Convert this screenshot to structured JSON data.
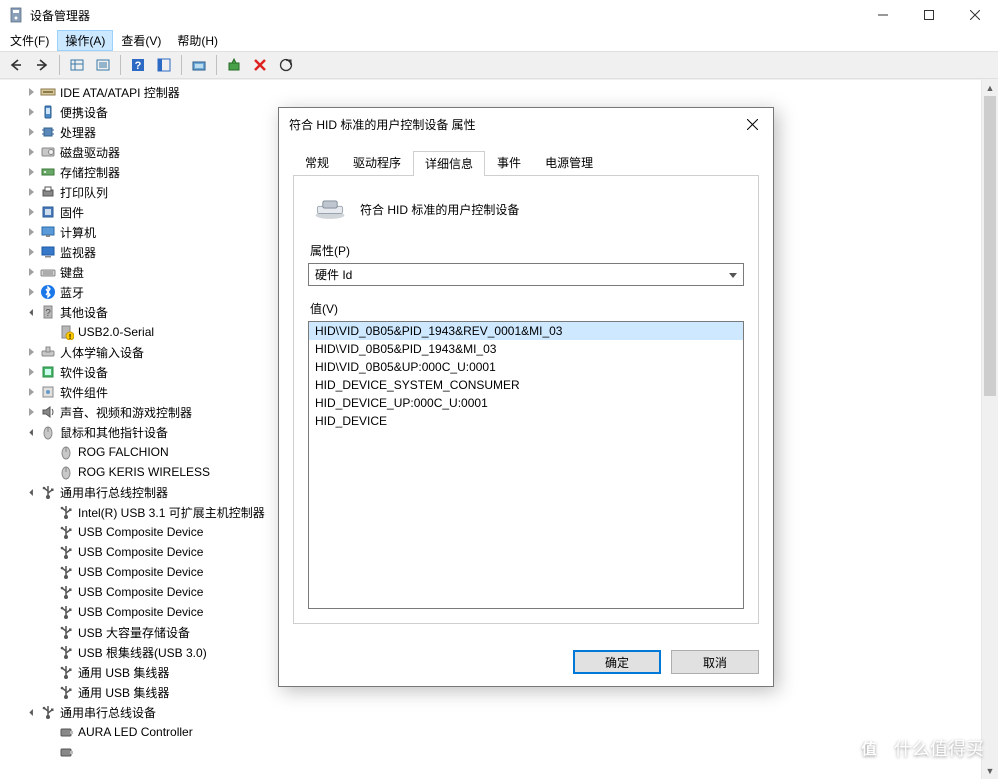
{
  "title": "设备管理器",
  "menus": {
    "file": "文件(F)",
    "action": "操作(A)",
    "view": "查看(V)",
    "help": "帮助(H)"
  },
  "tree": {
    "items": [
      {
        "indent": 1,
        "exp": "closed",
        "icon": "ide",
        "label": "IDE ATA/ATAPI 控制器"
      },
      {
        "indent": 1,
        "exp": "closed",
        "icon": "portable",
        "label": "便携设备"
      },
      {
        "indent": 1,
        "exp": "closed",
        "icon": "cpu",
        "label": "处理器"
      },
      {
        "indent": 1,
        "exp": "closed",
        "icon": "disk",
        "label": "磁盘驱动器"
      },
      {
        "indent": 1,
        "exp": "closed",
        "icon": "storage",
        "label": "存储控制器"
      },
      {
        "indent": 1,
        "exp": "closed",
        "icon": "printer",
        "label": "打印队列"
      },
      {
        "indent": 1,
        "exp": "closed",
        "icon": "firmware",
        "label": "固件"
      },
      {
        "indent": 1,
        "exp": "closed",
        "icon": "computer",
        "label": "计算机"
      },
      {
        "indent": 1,
        "exp": "closed",
        "icon": "monitor",
        "label": "监视器"
      },
      {
        "indent": 1,
        "exp": "closed",
        "icon": "keyboard",
        "label": "键盘"
      },
      {
        "indent": 1,
        "exp": "closed",
        "icon": "bluetooth",
        "label": "蓝牙"
      },
      {
        "indent": 1,
        "exp": "open",
        "icon": "unknown",
        "label": "其他设备"
      },
      {
        "indent": 2,
        "exp": "",
        "icon": "unknown-warn",
        "label": "USB2.0-Serial"
      },
      {
        "indent": 1,
        "exp": "closed",
        "icon": "hid",
        "label": "人体学输入设备"
      },
      {
        "indent": 1,
        "exp": "closed",
        "icon": "software",
        "label": "软件设备"
      },
      {
        "indent": 1,
        "exp": "closed",
        "icon": "component",
        "label": "软件组件"
      },
      {
        "indent": 1,
        "exp": "closed",
        "icon": "audio",
        "label": "声音、视频和游戏控制器"
      },
      {
        "indent": 1,
        "exp": "open",
        "icon": "mouse",
        "label": "鼠标和其他指针设备"
      },
      {
        "indent": 2,
        "exp": "",
        "icon": "mouse",
        "label": "ROG FALCHION"
      },
      {
        "indent": 2,
        "exp": "",
        "icon": "mouse",
        "label": "ROG KERIS WIRELESS"
      },
      {
        "indent": 1,
        "exp": "open",
        "icon": "usb",
        "label": "通用串行总线控制器"
      },
      {
        "indent": 2,
        "exp": "",
        "icon": "usb",
        "label": "Intel(R) USB 3.1 可扩展主机控制器"
      },
      {
        "indent": 2,
        "exp": "",
        "icon": "usb",
        "label": "USB Composite Device"
      },
      {
        "indent": 2,
        "exp": "",
        "icon": "usb",
        "label": "USB Composite Device"
      },
      {
        "indent": 2,
        "exp": "",
        "icon": "usb",
        "label": "USB Composite Device"
      },
      {
        "indent": 2,
        "exp": "",
        "icon": "usb",
        "label": "USB Composite Device"
      },
      {
        "indent": 2,
        "exp": "",
        "icon": "usb",
        "label": "USB Composite Device"
      },
      {
        "indent": 2,
        "exp": "",
        "icon": "usb",
        "label": "USB 大容量存储设备"
      },
      {
        "indent": 2,
        "exp": "",
        "icon": "usb",
        "label": "USB 根集线器(USB 3.0)"
      },
      {
        "indent": 2,
        "exp": "",
        "icon": "usb",
        "label": "通用 USB 集线器"
      },
      {
        "indent": 2,
        "exp": "",
        "icon": "usb",
        "label": "通用 USB 集线器"
      },
      {
        "indent": 1,
        "exp": "open",
        "icon": "usb",
        "label": "通用串行总线设备"
      },
      {
        "indent": 2,
        "exp": "",
        "icon": "usb-dev",
        "label": "AURA LED Controller"
      },
      {
        "indent": 2,
        "exp": "",
        "icon": "usb-dev",
        "label": ""
      }
    ]
  },
  "dialog": {
    "title": "符合 HID 标准的用户控制设备 属性",
    "tabs": {
      "general": "常规",
      "driver": "驱动程序",
      "details": "详细信息",
      "events": "事件",
      "power": "电源管理"
    },
    "device_name": "符合 HID 标准的用户控制设备",
    "property_label": "属性(P)",
    "property_value": "硬件 Id",
    "value_label": "值(V)",
    "values": [
      "HID\\VID_0B05&PID_1943&REV_0001&MI_03",
      "HID\\VID_0B05&PID_1943&MI_03",
      "HID\\VID_0B05&UP:000C_U:0001",
      "HID_DEVICE_SYSTEM_CONSUMER",
      "HID_DEVICE_UP:000C_U:0001",
      "HID_DEVICE"
    ],
    "ok_label": "确定",
    "cancel_label": "取消"
  },
  "watermark": "什么值得买"
}
